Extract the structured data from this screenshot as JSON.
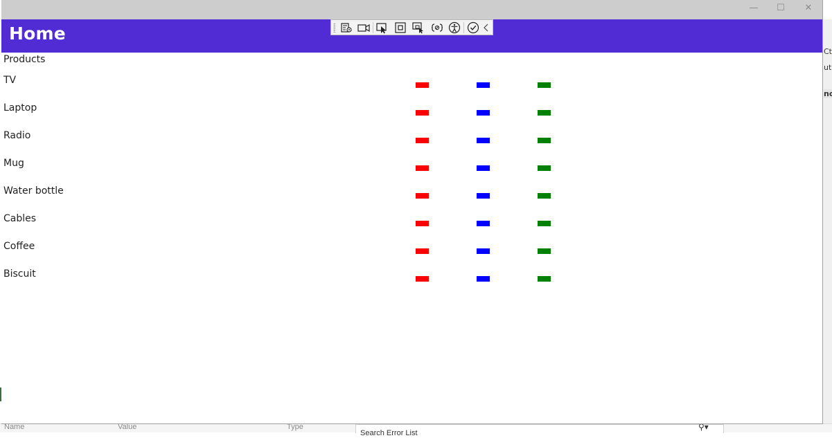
{
  "window": {
    "controls": {
      "minimize": "—",
      "maximize": "☐",
      "close": "✕"
    },
    "header_title": "Home",
    "header_color": "#512bd4"
  },
  "debug_toolbar": {
    "tools": [
      "live-visual-tree-icon",
      "video-icon",
      "select-element-icon",
      "display-adorners-icon",
      "track-focus-icon",
      "binding-failures-icon",
      "accessibility-icon",
      "checkmark-icon",
      "collapse-chevron-icon"
    ]
  },
  "products": {
    "title": "Products",
    "swatch_colors": [
      "#ff0000",
      "#0000ff",
      "#008000"
    ],
    "items": [
      {
        "name": "TV"
      },
      {
        "name": "Laptop"
      },
      {
        "name": "Radio"
      },
      {
        "name": "Mug"
      },
      {
        "name": "Water bottle"
      },
      {
        "name": "Cables"
      },
      {
        "name": "Coffee"
      },
      {
        "name": "Biscuit"
      }
    ]
  },
  "background_ide": {
    "right_fragments": [
      "Ctr",
      "utD",
      "no"
    ],
    "bottom_columns": [
      "Name",
      "Value",
      "Type"
    ],
    "search_placeholder": "Search Error List"
  }
}
